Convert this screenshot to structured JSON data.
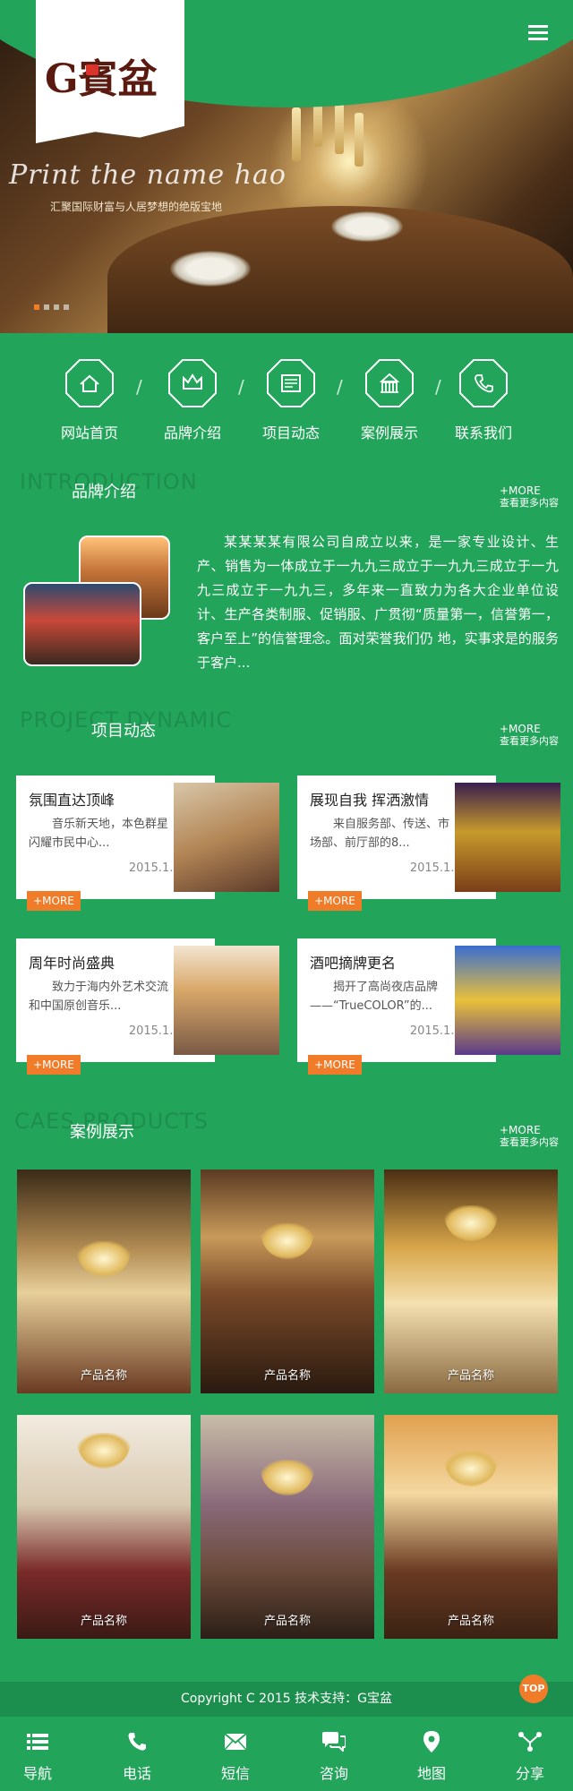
{
  "hero": {
    "script_text": "Print the name hao",
    "tagline": "汇聚国际财富与人居梦想的绝版宝地",
    "slide_count": 4,
    "active_slide": 1
  },
  "logo": {
    "text": "G賓盆"
  },
  "header": {
    "menu_icon": "menu-icon"
  },
  "nav": [
    {
      "label": "网站首页",
      "icon": "home-icon"
    },
    {
      "label": "品牌介绍",
      "icon": "crown-icon"
    },
    {
      "label": "项目动态",
      "icon": "news-icon"
    },
    {
      "label": "案例展示",
      "icon": "building-icon"
    },
    {
      "label": "联系我们",
      "icon": "phone-icon"
    }
  ],
  "nav_separator": "/",
  "intro": {
    "en": "INTRODUCTION",
    "title": "品牌介绍",
    "more": "+MORE",
    "more_sub": "查看更多内容",
    "text": "某某某某有限公司自成立以来，是一家专业设计、生产、销售为一体成立于一九九三成立于一九九三成立于一九九三成立于一九九三，多年来一直致力为各大企业单位设计、生产各类制服、促销服、广贯彻“质量第一，信誉第一，客户至上”的信誉理念。面对荣誉我们仍 地，实事求是的服务于客户..."
  },
  "projects": {
    "en": "PROJECT DYNAMIC",
    "title": "项目动态",
    "more": "+MORE",
    "more_sub": "查看更多内容",
    "btn": "+MORE",
    "items": [
      {
        "title": "氛围直达顶峰",
        "desc": "音乐新天地，本色群星闪耀市民中心...",
        "date": "2015.1.26"
      },
      {
        "title": "展现自我 挥洒激情",
        "desc": "来自服务部、传送、市场部、前厅部的8...",
        "date": "2015.1.26"
      },
      {
        "title": "周年时尚盛典",
        "desc": "致力于海内外艺术交流和中国原创音乐...",
        "date": "2015.1.26"
      },
      {
        "title": "酒吧摘牌更名",
        "desc": "揭开了高尚夜店品牌——“TrueCOLOR”的...",
        "date": "2015.1.26"
      }
    ]
  },
  "cases": {
    "en": "CAES PRODUCTS",
    "title": "案例展示",
    "more": "+MORE",
    "more_sub": "查看更多内容",
    "items": [
      {
        "name": "产品名称"
      },
      {
        "name": "产品名称"
      },
      {
        "name": "产品名称"
      },
      {
        "name": "产品名称"
      },
      {
        "name": "产品名称"
      },
      {
        "name": "产品名称"
      }
    ]
  },
  "footer": {
    "copyright": "Copyright C 2015 技术支持：G宝盆",
    "top": "TOP"
  },
  "bottom_nav": [
    {
      "label": "导航",
      "icon": "list-icon"
    },
    {
      "label": "电话",
      "icon": "phone-icon"
    },
    {
      "label": "短信",
      "icon": "mail-icon"
    },
    {
      "label": "咨询",
      "icon": "chat-icon"
    },
    {
      "label": "地图",
      "icon": "map-pin-icon"
    },
    {
      "label": "分享",
      "icon": "share-icon"
    }
  ],
  "colors": {
    "primary_green": "#22a45a",
    "accent_orange": "#f07c2a"
  }
}
